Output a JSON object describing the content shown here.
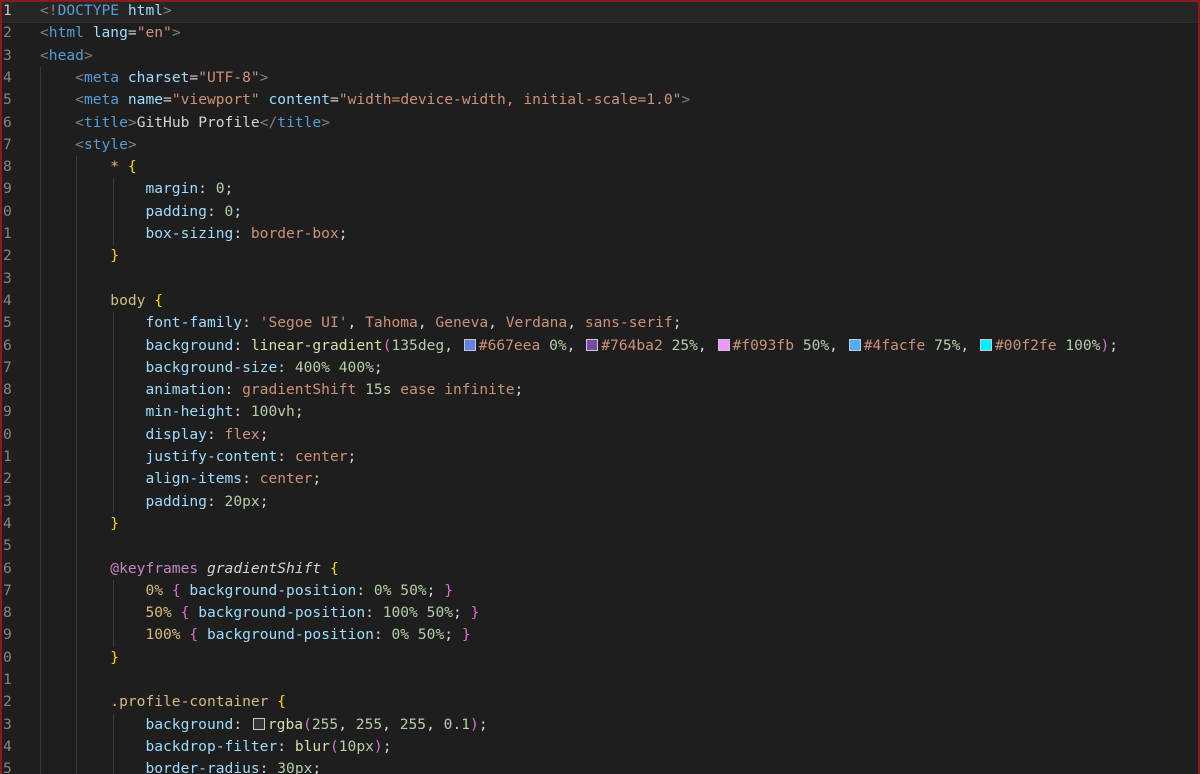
{
  "editor": {
    "lines": [
      {
        "n": "1",
        "tokens": [
          [
            "b",
            "<!"
          ],
          [
            "t",
            "DOCTYPE"
          ],
          [
            "a",
            " html"
          ],
          [
            "b",
            ">"
          ]
        ]
      },
      {
        "n": "2",
        "tokens": [
          [
            "b",
            "<"
          ],
          [
            "t",
            "html"
          ],
          [
            "a",
            " lang"
          ],
          [
            "p",
            "="
          ],
          [
            "s",
            "\"en\""
          ],
          [
            "b",
            ">"
          ]
        ]
      },
      {
        "n": "3",
        "tokens": [
          [
            "b",
            "<"
          ],
          [
            "t",
            "head"
          ],
          [
            "b",
            ">"
          ]
        ]
      },
      {
        "n": "4",
        "tokens": [
          [
            "p",
            "    "
          ],
          [
            "b",
            "<"
          ],
          [
            "t",
            "meta"
          ],
          [
            "a",
            " charset"
          ],
          [
            "p",
            "="
          ],
          [
            "s",
            "\"UTF-8\""
          ],
          [
            "b",
            ">"
          ]
        ]
      },
      {
        "n": "5",
        "tokens": [
          [
            "p",
            "    "
          ],
          [
            "b",
            "<"
          ],
          [
            "t",
            "meta"
          ],
          [
            "a",
            " name"
          ],
          [
            "p",
            "="
          ],
          [
            "s",
            "\"viewport\""
          ],
          [
            "a",
            " content"
          ],
          [
            "p",
            "="
          ],
          [
            "s",
            "\"width=device-width, initial-scale=1.0\""
          ],
          [
            "b",
            ">"
          ]
        ]
      },
      {
        "n": "6",
        "tokens": [
          [
            "p",
            "    "
          ],
          [
            "b",
            "<"
          ],
          [
            "t",
            "title"
          ],
          [
            "b",
            ">"
          ],
          [
            "p",
            "GitHub Profile"
          ],
          [
            "b",
            "</"
          ],
          [
            "t",
            "title"
          ],
          [
            "b",
            ">"
          ]
        ]
      },
      {
        "n": "7",
        "tokens": [
          [
            "p",
            "    "
          ],
          [
            "b",
            "<"
          ],
          [
            "t",
            "style"
          ],
          [
            "b",
            ">"
          ]
        ]
      },
      {
        "n": "8",
        "tokens": [
          [
            "p",
            "        "
          ],
          [
            "sel",
            "*"
          ],
          [
            "p",
            " "
          ],
          [
            "br1",
            "{"
          ]
        ]
      },
      {
        "n": "9",
        "tokens": [
          [
            "p",
            "            "
          ],
          [
            "a",
            "margin"
          ],
          [
            "p",
            ": "
          ],
          [
            "n",
            "0"
          ],
          [
            "p",
            ";"
          ]
        ]
      },
      {
        "n": "0",
        "tokens": [
          [
            "p",
            "            "
          ],
          [
            "a",
            "padding"
          ],
          [
            "p",
            ": "
          ],
          [
            "n",
            "0"
          ],
          [
            "p",
            ";"
          ]
        ]
      },
      {
        "n": "1",
        "tokens": [
          [
            "p",
            "            "
          ],
          [
            "a",
            "box-sizing"
          ],
          [
            "p",
            ": "
          ],
          [
            "v",
            "border-box"
          ],
          [
            "p",
            ";"
          ]
        ]
      },
      {
        "n": "2",
        "tokens": [
          [
            "p",
            "        "
          ],
          [
            "br1",
            "}"
          ]
        ]
      },
      {
        "n": "3",
        "tokens": []
      },
      {
        "n": "4",
        "tokens": [
          [
            "p",
            "        "
          ],
          [
            "sel",
            "body"
          ],
          [
            "p",
            " "
          ],
          [
            "br1",
            "{"
          ]
        ]
      },
      {
        "n": "5",
        "tokens": [
          [
            "p",
            "            "
          ],
          [
            "a",
            "font-family"
          ],
          [
            "p",
            ": "
          ],
          [
            "v",
            "'Segoe UI'"
          ],
          [
            "p",
            ", "
          ],
          [
            "v",
            "Tahoma"
          ],
          [
            "p",
            ", "
          ],
          [
            "v",
            "Geneva"
          ],
          [
            "p",
            ", "
          ],
          [
            "v",
            "Verdana"
          ],
          [
            "p",
            ", "
          ],
          [
            "v",
            "sans-serif"
          ],
          [
            "p",
            ";"
          ]
        ]
      },
      {
        "n": "6",
        "tokens": [
          [
            "p",
            "            "
          ],
          [
            "a",
            "background"
          ],
          [
            "p",
            ": "
          ],
          [
            "fn",
            "linear-gradient"
          ],
          [
            "br2",
            "("
          ],
          [
            "n",
            "135deg"
          ],
          [
            "p",
            ", "
          ],
          [
            "sw",
            "#667eea"
          ],
          [
            "v",
            "#667eea"
          ],
          [
            "p",
            " "
          ],
          [
            "n",
            "0%"
          ],
          [
            "p",
            ", "
          ],
          [
            "sw",
            "#764ba2"
          ],
          [
            "v",
            "#764ba2"
          ],
          [
            "p",
            " "
          ],
          [
            "n",
            "25%"
          ],
          [
            "p",
            ", "
          ],
          [
            "sw",
            "#f093fb"
          ],
          [
            "v",
            "#f093fb"
          ],
          [
            "p",
            " "
          ],
          [
            "n",
            "50%"
          ],
          [
            "p",
            ", "
          ],
          [
            "sw",
            "#4facfe"
          ],
          [
            "v",
            "#4facfe"
          ],
          [
            "p",
            " "
          ],
          [
            "n",
            "75%"
          ],
          [
            "p",
            ", "
          ],
          [
            "sw",
            "#00f2fe"
          ],
          [
            "v",
            "#00f2fe"
          ],
          [
            "p",
            " "
          ],
          [
            "n",
            "100%"
          ],
          [
            "br2",
            ")"
          ],
          [
            "p",
            ";"
          ]
        ]
      },
      {
        "n": "7",
        "tokens": [
          [
            "p",
            "            "
          ],
          [
            "a",
            "background-size"
          ],
          [
            "p",
            ": "
          ],
          [
            "n",
            "400%"
          ],
          [
            "p",
            " "
          ],
          [
            "n",
            "400%"
          ],
          [
            "p",
            ";"
          ]
        ]
      },
      {
        "n": "8",
        "tokens": [
          [
            "p",
            "            "
          ],
          [
            "a",
            "animation"
          ],
          [
            "p",
            ": "
          ],
          [
            "v",
            "gradientShift"
          ],
          [
            "p",
            " "
          ],
          [
            "n",
            "15s"
          ],
          [
            "p",
            " "
          ],
          [
            "v",
            "ease"
          ],
          [
            "p",
            " "
          ],
          [
            "v",
            "infinite"
          ],
          [
            "p",
            ";"
          ]
        ]
      },
      {
        "n": "9",
        "tokens": [
          [
            "p",
            "            "
          ],
          [
            "a",
            "min-height"
          ],
          [
            "p",
            ": "
          ],
          [
            "n",
            "100vh"
          ],
          [
            "p",
            ";"
          ]
        ]
      },
      {
        "n": "0",
        "tokens": [
          [
            "p",
            "            "
          ],
          [
            "a",
            "display"
          ],
          [
            "p",
            ": "
          ],
          [
            "v",
            "flex"
          ],
          [
            "p",
            ";"
          ]
        ]
      },
      {
        "n": "1",
        "tokens": [
          [
            "p",
            "            "
          ],
          [
            "a",
            "justify-content"
          ],
          [
            "p",
            ": "
          ],
          [
            "v",
            "center"
          ],
          [
            "p",
            ";"
          ]
        ]
      },
      {
        "n": "2",
        "tokens": [
          [
            "p",
            "            "
          ],
          [
            "a",
            "align-items"
          ],
          [
            "p",
            ": "
          ],
          [
            "v",
            "center"
          ],
          [
            "p",
            ";"
          ]
        ]
      },
      {
        "n": "3",
        "tokens": [
          [
            "p",
            "            "
          ],
          [
            "a",
            "padding"
          ],
          [
            "p",
            ": "
          ],
          [
            "n",
            "20px"
          ],
          [
            "p",
            ";"
          ]
        ]
      },
      {
        "n": "4",
        "tokens": [
          [
            "p",
            "        "
          ],
          [
            "br1",
            "}"
          ]
        ]
      },
      {
        "n": "5",
        "tokens": []
      },
      {
        "n": "6",
        "tokens": [
          [
            "p",
            "        "
          ],
          [
            "at",
            "@keyframes"
          ],
          [
            "p",
            " "
          ],
          [
            "it",
            "gradientShift"
          ],
          [
            "p",
            " "
          ],
          [
            "br1",
            "{"
          ]
        ]
      },
      {
        "n": "7",
        "tokens": [
          [
            "p",
            "            "
          ],
          [
            "sel",
            "0%"
          ],
          [
            "p",
            " "
          ],
          [
            "br2",
            "{"
          ],
          [
            "p",
            " "
          ],
          [
            "a",
            "background-position"
          ],
          [
            "p",
            ": "
          ],
          [
            "n",
            "0%"
          ],
          [
            "p",
            " "
          ],
          [
            "n",
            "50%"
          ],
          [
            "p",
            "; "
          ],
          [
            "br2",
            "}"
          ]
        ]
      },
      {
        "n": "8",
        "tokens": [
          [
            "p",
            "            "
          ],
          [
            "sel",
            "50%"
          ],
          [
            "p",
            " "
          ],
          [
            "br2",
            "{"
          ],
          [
            "p",
            " "
          ],
          [
            "a",
            "background-position"
          ],
          [
            "p",
            ": "
          ],
          [
            "n",
            "100%"
          ],
          [
            "p",
            " "
          ],
          [
            "n",
            "50%"
          ],
          [
            "p",
            "; "
          ],
          [
            "br2",
            "}"
          ]
        ]
      },
      {
        "n": "9",
        "tokens": [
          [
            "p",
            "            "
          ],
          [
            "sel",
            "100%"
          ],
          [
            "p",
            " "
          ],
          [
            "br2",
            "{"
          ],
          [
            "p",
            " "
          ],
          [
            "a",
            "background-position"
          ],
          [
            "p",
            ": "
          ],
          [
            "n",
            "0%"
          ],
          [
            "p",
            " "
          ],
          [
            "n",
            "50%"
          ],
          [
            "p",
            "; "
          ],
          [
            "br2",
            "}"
          ]
        ]
      },
      {
        "n": "0",
        "tokens": [
          [
            "p",
            "        "
          ],
          [
            "br1",
            "}"
          ]
        ]
      },
      {
        "n": "1",
        "tokens": []
      },
      {
        "n": "2",
        "tokens": [
          [
            "p",
            "        "
          ],
          [
            "sel",
            ".profile-container"
          ],
          [
            "p",
            " "
          ],
          [
            "br1",
            "{"
          ]
        ]
      },
      {
        "n": "3",
        "tokens": [
          [
            "p",
            "            "
          ],
          [
            "a",
            "background"
          ],
          [
            "p",
            ": "
          ],
          [
            "sw",
            "rgba(255,255,255,0.1)"
          ],
          [
            "fn",
            "rgba"
          ],
          [
            "br2",
            "("
          ],
          [
            "n",
            "255"
          ],
          [
            "p",
            ", "
          ],
          [
            "n",
            "255"
          ],
          [
            "p",
            ", "
          ],
          [
            "n",
            "255"
          ],
          [
            "p",
            ", "
          ],
          [
            "n",
            "0.1"
          ],
          [
            "br2",
            ")"
          ],
          [
            "p",
            ";"
          ]
        ]
      },
      {
        "n": "4",
        "tokens": [
          [
            "p",
            "            "
          ],
          [
            "a",
            "backdrop-filter"
          ],
          [
            "p",
            ": "
          ],
          [
            "fn",
            "blur"
          ],
          [
            "br2",
            "("
          ],
          [
            "n",
            "10px"
          ],
          [
            "br2",
            ")"
          ],
          [
            "p",
            ";"
          ]
        ]
      },
      {
        "n": "5",
        "tokens": [
          [
            "p",
            "            "
          ],
          [
            "a",
            "border-radius"
          ],
          [
            "p",
            ": "
          ],
          [
            "n",
            "30px"
          ],
          [
            "p",
            ";"
          ]
        ]
      }
    ]
  }
}
